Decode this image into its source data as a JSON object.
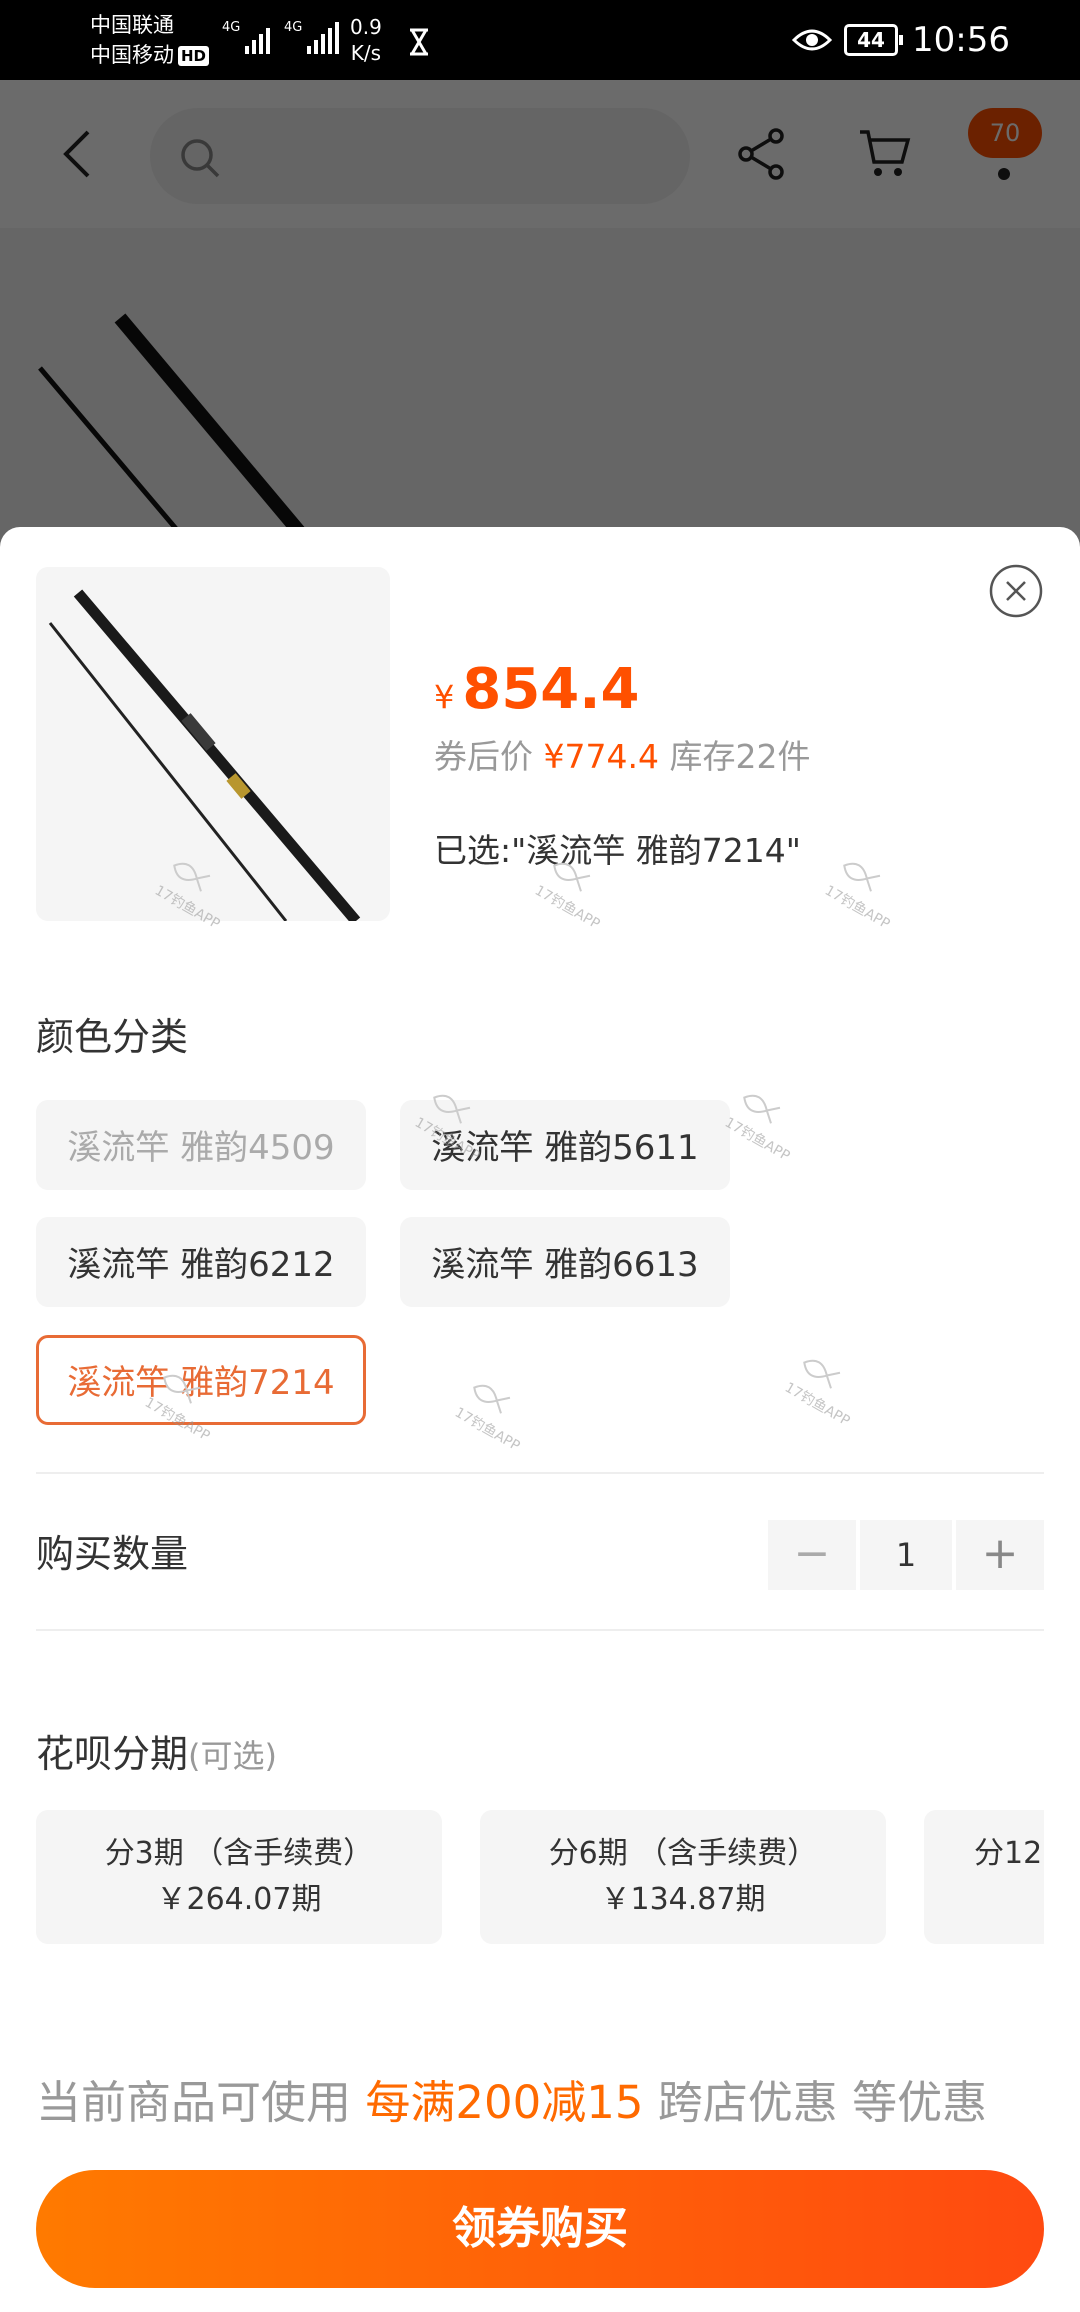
{
  "status_bar": {
    "carrier_1": "中国联通",
    "carrier_2": "中国移动",
    "hd": "HD",
    "network_1": "4G",
    "network_2": "4G",
    "speed_value": "0.9",
    "speed_unit": "K/s",
    "battery": "44",
    "time": "10:56"
  },
  "header": {
    "cart_badge": "70"
  },
  "product": {
    "currency_symbol": "¥",
    "price": "854.4",
    "coupon_label": "券后价",
    "coupon_price": "¥774.4",
    "stock": "库存22件",
    "selected_text": "已选:\"溪流竿 雅韵7214\""
  },
  "color_section": {
    "title": "颜色分类",
    "options": [
      {
        "label": "溪流竿 雅韵4509",
        "state": "disabled"
      },
      {
        "label": "溪流竿 雅韵5611",
        "state": "normal"
      },
      {
        "label": "溪流竿 雅韵6212",
        "state": "normal"
      },
      {
        "label": "溪流竿 雅韵6613",
        "state": "normal"
      },
      {
        "label": "溪流竿 雅韵7214",
        "state": "selected"
      }
    ]
  },
  "quantity": {
    "label": "购买数量",
    "minus": "−",
    "value": "1",
    "plus": "+"
  },
  "installments": {
    "title": "花呗分期",
    "optional": "(可选)",
    "plans": [
      {
        "term": "分3期 （含手续费）",
        "amount": "￥264.07期"
      },
      {
        "term": "分6期 （含手续费）",
        "amount": "￥134.87期"
      },
      {
        "term": "分12",
        "amount": ""
      }
    ]
  },
  "promo": {
    "prefix": "当前商品可使用",
    "highlight": "每满200减15",
    "suffix": "跨店优惠 等优惠"
  },
  "cta": {
    "label": "领券购买"
  },
  "watermark": {
    "text": "17钓鱼APP"
  },
  "colors": {
    "accent": "#ff5000",
    "selected_border": "#e86b35",
    "cta_gradient_start": "#ff7a00",
    "cta_gradient_end": "#ff4a10"
  }
}
